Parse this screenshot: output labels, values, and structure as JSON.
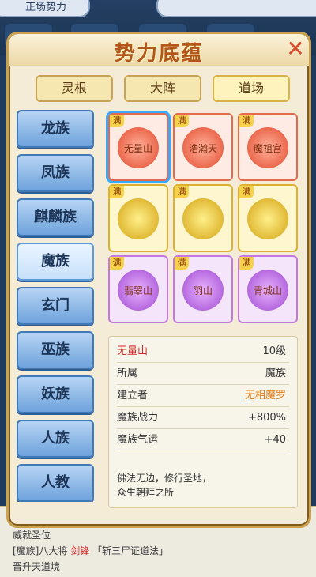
{
  "panel": {
    "title": "势力底蕴",
    "close_symbol": "✕"
  },
  "tabs": [
    "灵根",
    "大阵",
    "道场"
  ],
  "active_tab": 2,
  "clans": [
    "龙族",
    "凤族",
    "麒麟族",
    "魔族",
    "玄门",
    "巫族",
    "妖族",
    "人族",
    "人教"
  ],
  "selected_clan": 3,
  "grid": [
    {
      "name": "无量山",
      "badge": "满",
      "color": "red",
      "selected": true
    },
    {
      "name": "浩瀚天",
      "badge": "满",
      "color": "red"
    },
    {
      "name": "魔祖宫",
      "badge": "满",
      "color": "red"
    },
    {
      "name": "",
      "badge": "满",
      "color": "gold"
    },
    {
      "name": "",
      "badge": "满",
      "color": "gold"
    },
    {
      "name": "",
      "badge": "满",
      "color": "gold"
    },
    {
      "name": "翡翠山",
      "badge": "满",
      "color": "purple"
    },
    {
      "name": "羽山",
      "badge": "满",
      "color": "purple"
    },
    {
      "name": "青城山",
      "badge": "满",
      "color": "purple"
    }
  ],
  "details": {
    "name": "无量山",
    "level": "10级",
    "belong_label": "所属",
    "belong_value": "魔族",
    "founder_label": "建立者",
    "founder_value": "无相魔罗",
    "power_label": "魔族战力",
    "power_value": "+800%",
    "luck_label": "魔族气运",
    "luck_value": "+40",
    "description_line1": "佛法无边，修行圣地，",
    "description_line2": "众生朝拜之所"
  },
  "background": {
    "top_text": "正场势力",
    "log_line1": "威就圣位",
    "log_line2": "[魔族]八大将",
    "log_line2_highlight": "剑锋",
    "log_line2_rest": "「斩三尸证道法」",
    "log_line3": "晋升天道境"
  }
}
